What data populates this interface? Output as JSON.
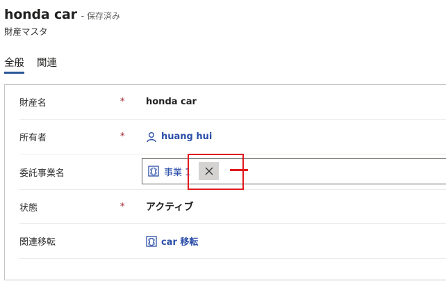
{
  "header": {
    "title": "honda car",
    "status": "- 保存済み",
    "entity": "財産マスタ"
  },
  "tabs": [
    {
      "label": "全般",
      "active": true
    },
    {
      "label": "関連",
      "active": false
    }
  ],
  "form": {
    "fields": [
      {
        "label": "財産名",
        "required_mark": "*",
        "value": "honda car"
      },
      {
        "label": "所有者",
        "required_mark": "*",
        "value": "huang hui",
        "icon": "person-icon"
      },
      {
        "label": "委託事業名",
        "value": "事業 1",
        "icon": "entity-icon"
      },
      {
        "label": "状態",
        "required_mark": "*",
        "value": "アクティブ"
      },
      {
        "label": "関連移転",
        "value": "car 移転",
        "icon": "entity-icon"
      }
    ]
  },
  "colors": {
    "accent": "#2b5797",
    "link": "#2b4fa8",
    "required": "#a4262c",
    "annotation": "#e0191d"
  }
}
